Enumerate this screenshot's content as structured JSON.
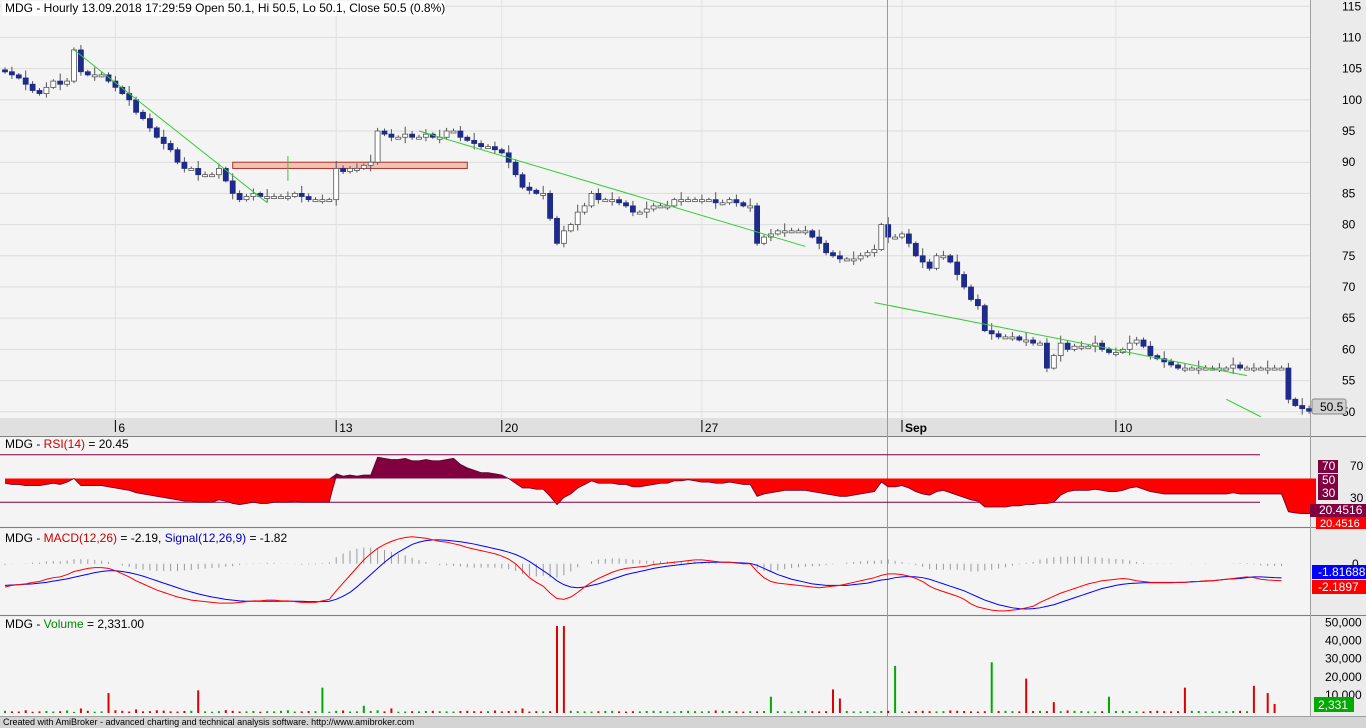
{
  "colors": {
    "bull": "#ffffff",
    "bear": "#1f2b8a",
    "trendline": "#33cc33",
    "rsi_fill": "#ff0000",
    "rsi_over": "#800040",
    "macd": "#ff0000",
    "signal": "#0000ff",
    "vol_up": "#00aa00",
    "vol_down": "#dd0000"
  },
  "footer": "Created with AmiBroker - advanced charting and technical analysis software. http://www.amibroker.com",
  "chart_data": [
    {
      "type": "candlestick",
      "title": "MDG - Hourly 13.09.2018 17:29:59 Open 50.1, Hi 50.5, Lo 50.1, Close 50.5 (0.8%)",
      "ylim": [
        49,
        116
      ],
      "y_ticks": [
        "115",
        "110",
        "105",
        "100",
        "95",
        "90",
        "85",
        "80",
        "75",
        "70",
        "65",
        "60",
        "55",
        "50"
      ],
      "x_labels": [
        {
          "label": "6",
          "bar": 16
        },
        {
          "label": "13",
          "bar": 48
        },
        {
          "label": "20",
          "bar": 72
        },
        {
          "label": "27",
          "bar": 101
        },
        {
          "label": "Sep",
          "bar": 130
        },
        {
          "label": "10",
          "bar": 161
        }
      ],
      "last_price_label": "50.5",
      "closes": [
        104.5,
        104,
        103.5,
        102.5,
        101.5,
        101,
        102,
        103,
        102.5,
        103,
        108,
        104.5,
        104,
        104,
        104,
        103,
        102,
        101,
        100,
        98,
        97,
        95.5,
        94,
        93,
        92,
        90,
        89,
        89,
        88,
        88,
        88,
        89,
        87,
        85,
        84,
        84.5,
        85,
        84.5,
        84.5,
        84.5,
        84.5,
        84.5,
        85,
        84.5,
        84,
        84,
        84,
        84,
        89,
        88.5,
        89,
        89,
        89.5,
        90,
        95,
        94.5,
        94,
        94,
        94.5,
        94,
        94,
        94.5,
        94,
        94,
        95,
        95,
        94,
        93.5,
        93,
        92.5,
        92.5,
        92,
        91.5,
        90,
        88,
        86,
        85.5,
        85,
        85,
        81,
        77,
        79,
        80,
        82,
        83,
        85,
        84,
        84,
        84,
        83.5,
        83,
        82,
        82,
        82.5,
        83,
        83,
        83,
        84,
        84,
        84,
        84,
        84,
        84,
        83.5,
        83.5,
        84,
        83.5,
        83,
        83,
        77,
        78,
        78.5,
        79,
        79,
        79,
        79,
        79,
        78,
        77,
        75.5,
        75,
        74.5,
        74.5,
        74.5,
        75,
        75.5,
        76,
        80,
        78,
        78,
        78.5,
        77,
        75,
        74,
        73,
        75,
        75,
        74,
        72,
        70,
        68,
        67,
        63,
        62.5,
        62,
        62,
        62,
        61.5,
        61.5,
        61,
        61,
        57,
        59,
        61,
        60,
        60.5,
        60.5,
        60.5,
        61,
        60,
        59.5,
        59.5,
        60,
        61,
        61.5,
        60.5,
        59,
        58.5,
        58,
        57.5,
        57,
        57,
        57,
        57,
        57,
        57,
        57,
        57,
        57.5,
        57,
        57,
        57,
        57,
        57,
        57,
        57,
        52,
        51,
        50.5,
        50.1,
        50.5
      ],
      "trendlines": [
        {
          "x1": 10,
          "y1": 108,
          "x2": 38,
          "y2": 83.5
        },
        {
          "x1": 41,
          "y1": 91,
          "x2": 41,
          "y2": 87
        },
        {
          "x1": 60,
          "y1": 95,
          "x2": 116,
          "y2": 76.5
        },
        {
          "x1": 126,
          "y1": 67.5,
          "x2": 180,
          "y2": 55.8
        },
        {
          "x1": 177,
          "y1": 52,
          "x2": 182,
          "y2": 49.2
        }
      ],
      "resistance_zone": {
        "bar_from": 33,
        "bar_to": 67,
        "top": 90,
        "bottom": 89
      }
    },
    {
      "type": "area",
      "title_name": "MDG - ",
      "title_ind": "RSI(14)",
      "title_val": " = 20.45",
      "ylim": [
        10,
        85
      ],
      "levels": [
        "70",
        "50",
        "30"
      ],
      "last_value_label": "20.4516",
      "values": [
        46,
        45,
        45,
        44,
        44,
        44,
        45,
        46,
        45,
        47,
        50,
        44,
        44,
        44,
        44,
        43,
        42,
        41,
        40,
        38,
        37,
        36,
        35,
        34,
        33,
        32,
        31,
        31,
        30,
        30,
        30,
        32,
        31,
        29,
        28,
        29,
        30,
        29,
        29,
        30,
        30,
        30,
        31,
        30,
        30,
        30,
        30,
        30,
        54,
        52,
        53,
        52,
        53,
        53,
        68,
        67,
        66,
        66,
        67,
        65,
        65,
        66,
        65,
        65,
        66,
        67,
        62,
        59,
        57,
        55,
        55,
        54,
        53,
        50,
        46,
        42,
        42,
        41,
        41,
        35,
        28,
        34,
        37,
        42,
        45,
        48,
        46,
        46,
        46,
        45,
        45,
        43,
        43,
        44,
        45,
        46,
        46,
        48,
        48,
        49,
        48,
        47,
        47,
        46,
        46,
        47,
        46,
        45,
        45,
        35,
        37,
        38,
        39,
        40,
        40,
        40,
        40,
        39,
        38,
        37,
        36,
        35,
        35,
        36,
        37,
        38,
        39,
        47,
        43,
        43,
        44,
        42,
        39,
        37,
        36,
        39,
        40,
        38,
        36,
        34,
        32,
        31,
        26,
        26,
        26,
        26,
        27,
        27,
        28,
        28,
        29,
        29,
        30,
        36,
        39,
        40,
        40,
        40,
        41,
        40,
        39,
        39,
        40,
        42,
        43,
        41,
        39,
        38,
        37,
        37,
        37,
        37,
        37,
        37,
        37,
        37,
        37,
        37,
        38,
        37,
        37,
        37,
        37,
        37,
        37,
        37,
        22,
        21,
        20.5,
        20.4,
        20.45
      ]
    },
    {
      "type": "line",
      "title_name": "MDG - ",
      "title_macd": "MACD(12,26)",
      "title_macd_val": " = -2.19, ",
      "title_signal": "Signal(12,26,9)",
      "title_signal_val": " = -1.82",
      "ylim": [
        -6.5,
        4.5
      ],
      "y_ticks": [
        "0"
      ],
      "macd_label": "-2.1897",
      "signal_label": "-1.81688",
      "series": [
        {
          "values": [
            -3.0,
            -2.8,
            -2.7,
            -2.6,
            -2.4,
            -2.3,
            -2.0,
            -1.8,
            -1.7,
            -1.4,
            -1.0,
            -0.8,
            -0.6,
            -0.5,
            -0.5,
            -0.6,
            -0.9,
            -1.3,
            -1.7,
            -2.2,
            -2.6,
            -3.0,
            -3.4,
            -3.7,
            -4.0,
            -4.3,
            -4.5,
            -4.7,
            -4.8,
            -4.9,
            -5.0,
            -5.1,
            -5.1,
            -5.1,
            -5.0,
            -4.9,
            -4.8,
            -4.8,
            -4.7,
            -4.7,
            -4.8,
            -4.8,
            -4.9,
            -5.0,
            -5.0,
            -5.0,
            -4.8,
            -4.6,
            -3.5,
            -2.5,
            -1.5,
            -0.5,
            0.5,
            1.3,
            2.0,
            2.5,
            2.9,
            3.2,
            3.4,
            3.5,
            3.4,
            3.3,
            3.1,
            2.9,
            2.8,
            2.6,
            2.4,
            2.1,
            1.9,
            1.7,
            1.5,
            1.3,
            1.0,
            0.6,
            0.0,
            -0.9,
            -1.8,
            -2.4,
            -2.9,
            -3.8,
            -4.5,
            -4.6,
            -4.3,
            -3.7,
            -3.0,
            -2.4,
            -1.9,
            -1.5,
            -1.1,
            -0.8,
            -0.6,
            -0.5,
            -0.4,
            -0.3,
            -0.1,
            0.0,
            0.1,
            0.2,
            0.3,
            0.4,
            0.5,
            0.5,
            0.4,
            0.3,
            0.2,
            0.2,
            0.1,
            0.0,
            0.0,
            -1.0,
            -1.8,
            -2.3,
            -2.5,
            -2.6,
            -2.7,
            -2.8,
            -2.9,
            -3.0,
            -3.1,
            -3.0,
            -2.9,
            -2.8,
            -2.6,
            -2.4,
            -2.2,
            -2.0,
            -1.8,
            -1.5,
            -1.3,
            -1.3,
            -1.4,
            -1.6,
            -1.9,
            -2.3,
            -2.9,
            -3.3,
            -3.6,
            -3.9,
            -4.2,
            -4.6,
            -5.2,
            -5.6,
            -5.8,
            -6.0,
            -6.1,
            -6.1,
            -6.0,
            -5.9,
            -5.7,
            -5.5,
            -5.0,
            -4.6,
            -4.2,
            -3.8,
            -3.5,
            -3.2,
            -2.9,
            -2.6,
            -2.4,
            -2.2,
            -2.1,
            -2.0,
            -1.9,
            -2.0,
            -2.2,
            -2.3,
            -2.4,
            -2.4,
            -2.4,
            -2.4,
            -2.4,
            -2.4,
            -2.3,
            -2.3,
            -2.2,
            -2.2,
            -2.1,
            -2.0,
            -1.9,
            -1.8,
            -1.7,
            -1.8,
            -2.0,
            -2.1,
            -2.15,
            -2.19
          ]
        },
        {
          "values": [
            -2.8,
            -2.75,
            -2.7,
            -2.65,
            -2.6,
            -2.5,
            -2.4,
            -2.25,
            -2.1,
            -1.95,
            -1.75,
            -1.55,
            -1.35,
            -1.15,
            -1.0,
            -0.9,
            -0.9,
            -1.0,
            -1.15,
            -1.35,
            -1.6,
            -1.9,
            -2.2,
            -2.5,
            -2.8,
            -3.1,
            -3.4,
            -3.65,
            -3.9,
            -4.1,
            -4.3,
            -4.45,
            -4.6,
            -4.7,
            -4.8,
            -4.85,
            -4.85,
            -4.85,
            -4.85,
            -4.85,
            -4.85,
            -4.85,
            -4.85,
            -4.85,
            -4.9,
            -4.9,
            -4.9,
            -4.85,
            -4.6,
            -4.2,
            -3.7,
            -3.0,
            -2.2,
            -1.4,
            -0.6,
            0.2,
            0.9,
            1.5,
            2.0,
            2.5,
            2.8,
            3.0,
            3.1,
            3.1,
            3.05,
            2.95,
            2.85,
            2.7,
            2.55,
            2.35,
            2.15,
            1.95,
            1.75,
            1.5,
            1.2,
            0.8,
            0.3,
            -0.3,
            -0.9,
            -1.5,
            -2.2,
            -2.7,
            -3.0,
            -3.1,
            -3.0,
            -2.8,
            -2.6,
            -2.3,
            -2.0,
            -1.7,
            -1.4,
            -1.2,
            -1.0,
            -0.8,
            -0.6,
            -0.45,
            -0.3,
            -0.2,
            -0.1,
            0.0,
            0.1,
            0.15,
            0.2,
            0.2,
            0.2,
            0.2,
            0.15,
            0.1,
            0.05,
            -0.2,
            -0.6,
            -1.0,
            -1.4,
            -1.7,
            -2.0,
            -2.2,
            -2.4,
            -2.6,
            -2.7,
            -2.8,
            -2.8,
            -2.8,
            -2.8,
            -2.7,
            -2.6,
            -2.5,
            -2.3,
            -2.1,
            -2.0,
            -1.8,
            -1.7,
            -1.65,
            -1.7,
            -1.8,
            -2.0,
            -2.3,
            -2.6,
            -2.9,
            -3.2,
            -3.5,
            -3.9,
            -4.3,
            -4.7,
            -5.0,
            -5.3,
            -5.5,
            -5.7,
            -5.8,
            -5.85,
            -5.8,
            -5.7,
            -5.5,
            -5.3,
            -5.0,
            -4.7,
            -4.4,
            -4.1,
            -3.8,
            -3.5,
            -3.2,
            -3.0,
            -2.8,
            -2.65,
            -2.55,
            -2.5,
            -2.45,
            -2.45,
            -2.45,
            -2.45,
            -2.45,
            -2.4,
            -2.4,
            -2.35,
            -2.3,
            -2.25,
            -2.2,
            -2.1,
            -2.0,
            -1.95,
            -1.9,
            -1.8,
            -1.7,
            -1.7,
            -1.75,
            -1.8,
            -1.82
          ]
        }
      ]
    },
    {
      "type": "bar",
      "title_name": "MDG - ",
      "title_ind": "Volume",
      "title_val": " = 2,331.00",
      "ylim": [
        0,
        53000
      ],
      "y_ticks": [
        "50,000",
        "40,000",
        "30,000",
        "20,000",
        "10,000"
      ],
      "last_value_label": "2,331",
      "values": [
        1200,
        900,
        800,
        1500,
        700,
        900,
        1100,
        800,
        1000,
        1400,
        600,
        2500,
        1200,
        700,
        900,
        11000,
        1500,
        1200,
        800,
        2000,
        900,
        1000,
        1500,
        1300,
        900,
        800,
        1100,
        1200,
        1500,
        900,
        700,
        1000,
        1600,
        1200,
        800,
        900,
        1100,
        700,
        1000,
        900,
        1200,
        1500,
        800,
        900,
        1100,
        1000,
        900,
        700,
        1200,
        1400,
        800,
        900,
        1000,
        1100,
        1500,
        900,
        2500,
        700,
        800,
        1000,
        900,
        1100,
        1200,
        1000,
        900,
        800,
        1100,
        1200,
        1000,
        900,
        1000,
        1400,
        900,
        1100,
        1200,
        2500,
        800,
        1000,
        900,
        1000,
        48000,
        1500,
        1200,
        1000,
        900,
        800,
        1000,
        1100,
        1200,
        900,
        800,
        1000,
        900,
        1100,
        1200,
        1000,
        900,
        800,
        1100,
        1200,
        1000,
        900,
        1000,
        1400,
        1200,
        1100,
        900,
        800,
        1000,
        900,
        1100,
        1200,
        1000,
        900,
        800,
        1100,
        1200,
        1000,
        900,
        1000,
        1400,
        1200,
        1100,
        900,
        800,
        1000,
        900,
        1100,
        1200,
        1000,
        900,
        800,
        1100,
        1200,
        1000,
        900,
        1000,
        1400,
        1200,
        1100,
        900,
        800,
        1000,
        900,
        1100,
        1200,
        1000,
        900,
        800,
        1100,
        1200,
        1000,
        900,
        1000,
        1400,
        1200,
        1100,
        900,
        800,
        1000,
        900,
        1100,
        1200,
        1000,
        900,
        800,
        1100,
        1200,
        1000,
        900,
        1000,
        1400,
        1200,
        1100,
        900,
        800,
        1000,
        900,
        1100,
        1200,
        1000,
        2331
      ],
      "spikes": [
        {
          "bar": 28,
          "v": 12500,
          "up": false
        },
        {
          "bar": 46,
          "v": 14000,
          "up": true
        },
        {
          "bar": 52,
          "v": 4000,
          "up": true
        },
        {
          "bar": 81,
          "v": 48000,
          "up": false
        },
        {
          "bar": 111,
          "v": 9000,
          "up": true
        },
        {
          "bar": 120,
          "v": 13000,
          "up": false
        },
        {
          "bar": 121,
          "v": 8000,
          "up": false
        },
        {
          "bar": 129,
          "v": 26000,
          "up": true
        },
        {
          "bar": 143,
          "v": 28000,
          "up": true
        },
        {
          "bar": 148,
          "v": 19000,
          "up": false
        },
        {
          "bar": 152,
          "v": 6000,
          "up": false
        },
        {
          "bar": 160,
          "v": 9000,
          "up": true
        },
        {
          "bar": 171,
          "v": 14000,
          "up": false
        },
        {
          "bar": 181,
          "v": 15000,
          "up": false
        },
        {
          "bar": 183,
          "v": 11000,
          "up": false
        },
        {
          "bar": 184,
          "v": 5000,
          "up": false
        }
      ]
    }
  ]
}
